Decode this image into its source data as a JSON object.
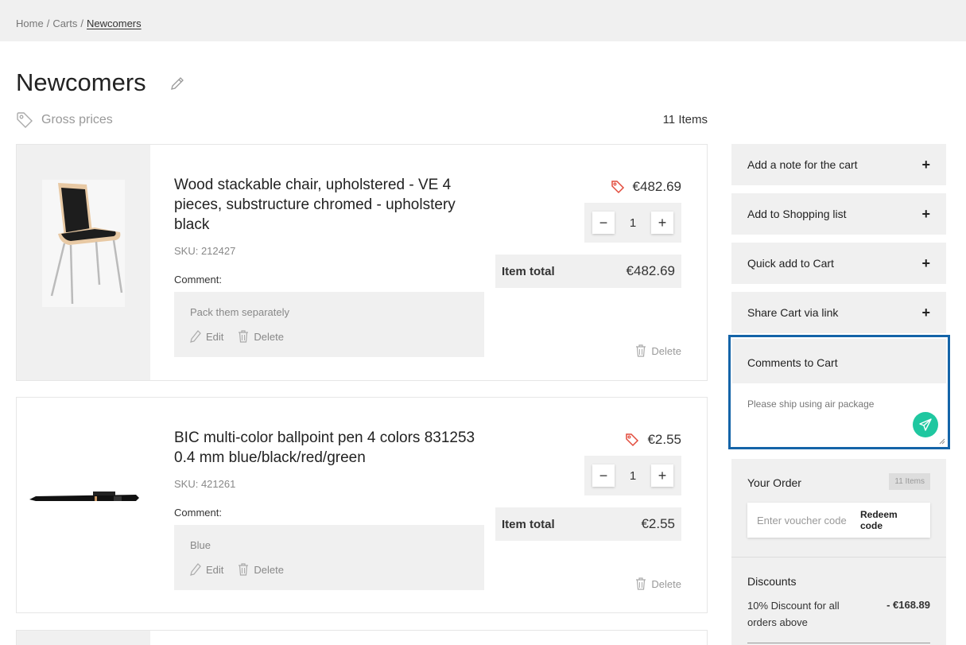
{
  "breadcrumb": {
    "items": [
      "Home",
      "Carts"
    ],
    "separator": "/",
    "current": "Newcomers"
  },
  "page": {
    "title": "Newcomers",
    "price_mode": "Gross prices",
    "item_count": "11 Items"
  },
  "items": [
    {
      "name": "Wood stackable chair, upholstered - VE 4 pieces, substructure chromed - upholstery black",
      "sku": "SKU: 212427",
      "comment_label": "Comment:",
      "comment_text": "Pack them separately",
      "edit_label": "Edit",
      "delete_comment_label": "Delete",
      "unit_price": "€482.69",
      "quantity": "1",
      "total_label": "Item total",
      "total_value": "€482.69",
      "delete_label": "Delete"
    },
    {
      "name": "BIC multi-color ballpoint pen 4 colors 831253 0.4 mm blue/black/red/green",
      "sku": "SKU: 421261",
      "comment_label": "Comment:",
      "comment_text": "Blue",
      "edit_label": "Edit",
      "delete_comment_label": "Delete",
      "unit_price": "€2.55",
      "quantity": "1",
      "total_label": "Item total",
      "total_value": "€2.55",
      "delete_label": "Delete"
    }
  ],
  "qty_controls": {
    "minus": "−",
    "plus": "+"
  },
  "sidebar": {
    "panels": [
      {
        "label": "Add a note for the cart",
        "icon": "+"
      },
      {
        "label": "Add to Shopping list",
        "icon": "+"
      },
      {
        "label": "Quick add to Cart",
        "icon": "+"
      },
      {
        "label": "Share Cart via link",
        "icon": "+"
      }
    ],
    "comments": {
      "title": "Comments to Cart",
      "value": "Please ship using air package"
    },
    "order": {
      "title": "Your Order",
      "badge": "11 Items",
      "voucher_placeholder": "Enter voucher code",
      "redeem_label": "Redeem code",
      "discounts_title": "Discounts",
      "discount_text": "10% Discount for all orders above",
      "discount_value": "- €168.89"
    }
  },
  "colors": {
    "panel_bg": "#f0f0f0",
    "focus_border": "#1464a8",
    "send_button": "#1fc7a0",
    "price_tag_icon": "#e24a3b"
  }
}
